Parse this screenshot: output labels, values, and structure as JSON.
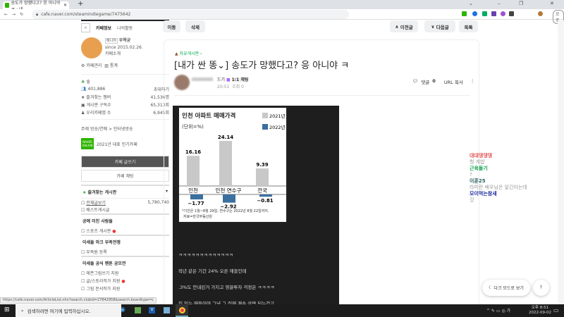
{
  "browser": {
    "tab_title": "송도가 망했다고? 응 아니야 ㅋ : 네",
    "url": "cafe.naver.com/steamindiegame/7475642",
    "profile_label": "오주"
  },
  "sidebar": {
    "tab_cafe_info": "카페정보",
    "tab_my_activity": "나의활동",
    "manager_badge": "매니저",
    "manager_name": "우왁굳",
    "since": "since 2015.02.26.",
    "cafe_intro": "카페소개",
    "cafe_admin": "카페관리",
    "stats": "통계",
    "level": "숲",
    "members": "401,886",
    "invite": "초대하기",
    "fav_members_label": "즐겨찾는 멤버",
    "fav_members_value": "41,536명",
    "board_subs_label": "게시판 구독수",
    "board_subs_value": "65,313회",
    "our_cafe_label": "우리카페앱 수",
    "our_cafe_value": "6,945회",
    "theme": "주제 방송/연예 > 인터넷방송",
    "naver_badge": "NAVER 대표카페",
    "award": "2021년 대표 인기카페",
    "write_button": "카페 글쓰기",
    "chat_button": "카페 채팅",
    "fav_boards": "즐겨찾는 게시판",
    "all_posts": "전체글보기",
    "all_posts_count": "5,780,740",
    "best_posts": "베스트게시글",
    "section1": "공예 미친 사람들",
    "sports_board": "스포츠 게시판",
    "section2": "이세돌 마크 부족전쟁",
    "tribe_register": "부족원 등록",
    "section3": "이세돌 공식 팬튼 공모전",
    "board_a": "에픈그림쓰기 지원",
    "board_b": "글/스토리작가 지원",
    "board_c": "그림 문서작가 지원"
  },
  "toolbar": {
    "move": "이동",
    "delete": "삭제",
    "prev": "이전글",
    "next": "다음글",
    "list": "목록"
  },
  "post": {
    "board": "자유게시판",
    "title": "[내가 싼 똥⌄] 송도가 망했다고? 응 아니야 ㅋ",
    "author_level": "드기",
    "chat": "1:1 채팅",
    "time": "20:51",
    "views": "조회 0",
    "comments_label": "댓글",
    "comments_count": "0",
    "url_copy": "URL 복사",
    "lines": [
      "ㅋㅋㅋㅋㅋㅋㅋㅋㅋㅋㅋㅋㅋ",
      "작년 같은 기간 24% 오른 애들인데",
      ".3%도 안내린거 가지고 영끌투자 걱정은 ㅋㅋㅋㅋ",
      "집 있는 애들이야 그냥 그 집에 계속 살면 되는건고"
    ]
  },
  "chart_data": {
    "type": "bar",
    "title": "인천 아파트 매매가격",
    "unit": "(단위=%)",
    "categories": [
      "인천",
      "인천 연수구",
      "전국"
    ],
    "series": [
      {
        "name": "2021년",
        "color": "#c8c8c8",
        "values": [
          16.16,
          24.14,
          9.39
        ]
      },
      {
        "name": "2022년",
        "color": "#3a6fa0",
        "values": [
          -1.77,
          -2.92,
          -0.81
        ]
      }
    ],
    "labels_2021": [
      "16.16",
      "24.14",
      "9.39"
    ],
    "labels_2022": [
      "−1.77",
      "−2.92",
      "−0.81"
    ],
    "footnote": "*기간은 1월~8월 29일, 연수구는 2022년 8월 22일까지.",
    "source": "자료=한국부동산원",
    "legend": "top-right"
  },
  "comments": [
    {
      "name": "대대댕댕댕",
      "color": "#e05050",
      "text": "헝 게밥"
    },
    {
      "name": "근육돌기",
      "color": "#11a050",
      "text": "?"
    },
    {
      "name": "이훈25",
      "color": "#2a6060",
      "text": "라미란 배우님은 알긴아는데"
    },
    {
      "name": "모이먹는참새",
      "color": "#1a2aa0",
      "text": "갓"
    }
  ],
  "floating": {
    "dark_mode": "다크 모드로 보기"
  },
  "status_url": "https://cafe.naver.com/ArticleList.nhn?search.clubid=27842958&search.boardtype=L",
  "taskbar": {
    "search_placeholder": "검색하려면 여기에 입력하십시오.",
    "time": "오후 8:51",
    "date": "2022-09-02"
  }
}
